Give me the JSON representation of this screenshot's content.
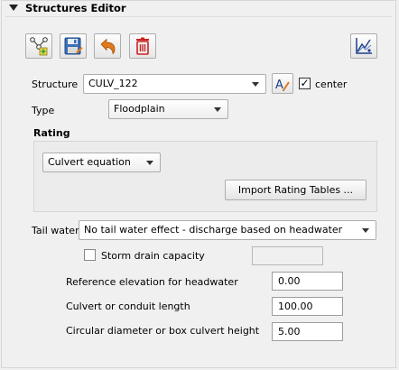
{
  "panel": {
    "title": "Structures Editor"
  },
  "toolbar": {
    "buttons": [
      {
        "icon": "add-structure-icon"
      },
      {
        "icon": "save-icon"
      },
      {
        "icon": "undo-icon"
      },
      {
        "icon": "delete-icon"
      }
    ],
    "right_button_icon": "profile-chart-icon"
  },
  "structure": {
    "label": "Structure",
    "value": "CULV_122",
    "rename_button_icon": "rename-icon",
    "center_checked": true,
    "center_label": "center"
  },
  "type": {
    "label": "Type",
    "value": "Floodplain"
  },
  "rating": {
    "group_label": "Rating",
    "value": "Culvert equation",
    "import_button_label": "Import Rating Tables ..."
  },
  "tail_water": {
    "label": "Tail water",
    "value": "No tail water effect - discharge based on headwater"
  },
  "storm_drain": {
    "label": "Storm drain capacity",
    "checked": false,
    "value": ""
  },
  "fields": [
    {
      "label": "Reference elevation for headwater",
      "value": "0.00"
    },
    {
      "label": "Culvert or conduit length",
      "value": "100.00"
    },
    {
      "label": "Circular diameter or box culvert height",
      "value": "5.00"
    }
  ],
  "colors": {
    "save_blue": "#3b6fb6",
    "delete_red": "#cc2222",
    "undo_orange": "#e07a1f",
    "add_green": "#3a9a3a"
  }
}
